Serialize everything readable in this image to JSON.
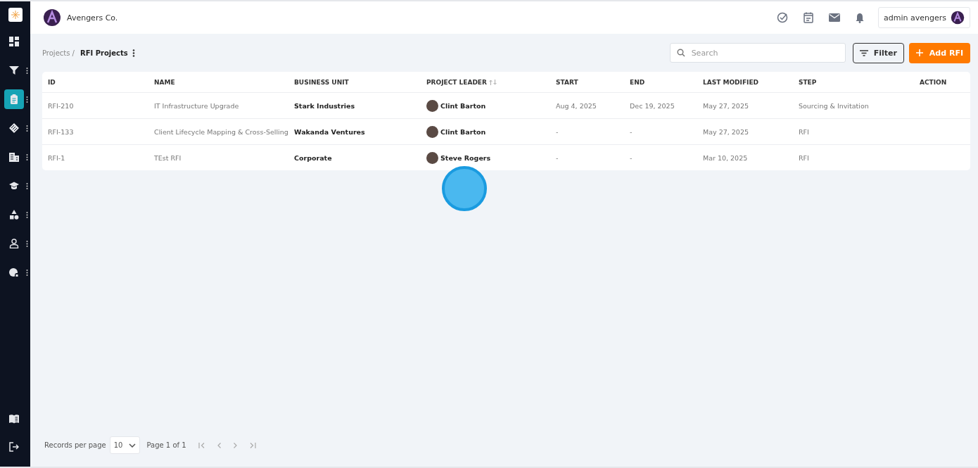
{
  "sidebar": {
    "items": [
      {
        "kind": "dashboard",
        "has_menu": false,
        "selected": false
      },
      {
        "kind": "filter",
        "has_menu": true,
        "selected": false
      },
      {
        "kind": "clipboard",
        "has_menu": true,
        "selected": true
      },
      {
        "kind": "handshake",
        "has_menu": true,
        "selected": false
      },
      {
        "kind": "building",
        "has_menu": true,
        "selected": false
      },
      {
        "kind": "graduation",
        "has_menu": true,
        "selected": false
      },
      {
        "kind": "shapes",
        "has_menu": true,
        "selected": false
      },
      {
        "kind": "person",
        "has_menu": true,
        "selected": false
      },
      {
        "kind": "shield",
        "has_menu": true,
        "selected": false
      }
    ],
    "bottom_items": [
      {
        "kind": "book"
      },
      {
        "kind": "logout"
      }
    ]
  },
  "header": {
    "company": "Avengers Co.",
    "user": "admin avengers"
  },
  "breadcrumb": {
    "parent": "Projects /",
    "current": "RFI Projects"
  },
  "search": {
    "placeholder": "Search"
  },
  "filter_button": "Filter",
  "add_button": "Add RFI",
  "table": {
    "columns": [
      {
        "label": "ID",
        "sortable": false
      },
      {
        "label": "NAME",
        "sortable": false
      },
      {
        "label": "BUSINESS UNIT",
        "sortable": false
      },
      {
        "label": "PROJECT LEADER",
        "sortable": true
      },
      {
        "label": "START",
        "sortable": false
      },
      {
        "label": "END",
        "sortable": false
      },
      {
        "label": "LAST MODIFIED",
        "sortable": false
      },
      {
        "label": "STEP",
        "sortable": false
      },
      {
        "label": "ACTION",
        "sortable": false
      }
    ],
    "rows": [
      {
        "id": "RFI-210",
        "name": "IT Infrastructure Upgrade",
        "business_unit": "Stark Industries",
        "leader": "Clint Barton",
        "start": "Aug 4, 2025",
        "end": "Dec 19, 2025",
        "last_modified": "May 27, 2025",
        "step": "Sourcing & Invitation"
      },
      {
        "id": "RFI-133",
        "name": "Client Lifecycle Mapping & Cross-Selling",
        "business_unit": "Wakanda Ventures",
        "leader": "Clint Barton",
        "start": "-",
        "end": "-",
        "last_modified": "May 27, 2025",
        "step": "RFI"
      },
      {
        "id": "RFI-1",
        "name": "TEst RFI",
        "business_unit": "Corporate",
        "leader": "Steve Rogers",
        "start": "-",
        "end": "-",
        "last_modified": "Mar 10, 2025",
        "step": "RFI"
      }
    ]
  },
  "pagination": {
    "label": "Records per page",
    "per_page": "10",
    "page": "Page 1 of 1"
  }
}
